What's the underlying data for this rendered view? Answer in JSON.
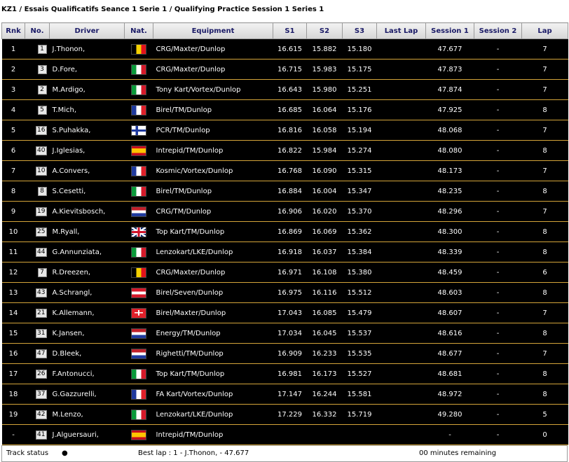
{
  "title": "KZ1 / Essais Qualificatifs Seance 1 Serie 1 / Qualifying Practice Session 1 Series 1",
  "columns": [
    "Rnk",
    "No.",
    "Driver",
    "Nat.",
    "Equipment",
    "S1",
    "S2",
    "S3",
    "Last Lap",
    "Session 1",
    "Session 2",
    "Lap"
  ],
  "rows": [
    {
      "rnk": "1",
      "no": "1",
      "driver": "J.Thonon,",
      "nat": "BE",
      "equip": "CRG/Maxter/Dunlop",
      "s1": "16.615",
      "s2": "15.882",
      "s3": "15.180",
      "last": "",
      "sess1": "47.677",
      "sess2": "-",
      "lap": "7"
    },
    {
      "rnk": "2",
      "no": "3",
      "driver": "D.Fore,",
      "nat": "IT",
      "equip": "CRG/Maxter/Dunlop",
      "s1": "16.715",
      "s2": "15.983",
      "s3": "15.175",
      "last": "",
      "sess1": "47.873",
      "sess2": "-",
      "lap": "7"
    },
    {
      "rnk": "3",
      "no": "2",
      "driver": "M.Ardigo,",
      "nat": "IT",
      "equip": "Tony Kart/Vortex/Dunlop",
      "s1": "16.643",
      "s2": "15.980",
      "s3": "15.251",
      "last": "",
      "sess1": "47.874",
      "sess2": "-",
      "lap": "7"
    },
    {
      "rnk": "4",
      "no": "5",
      "driver": "T.Mich,",
      "nat": "FR",
      "equip": "Birel/TM/Dunlop",
      "s1": "16.685",
      "s2": "16.064",
      "s3": "15.176",
      "last": "",
      "sess1": "47.925",
      "sess2": "-",
      "lap": "8"
    },
    {
      "rnk": "5",
      "no": "16",
      "driver": "S.Puhakka,",
      "nat": "FI",
      "equip": "PCR/TM/Dunlop",
      "s1": "16.816",
      "s2": "16.058",
      "s3": "15.194",
      "last": "",
      "sess1": "48.068",
      "sess2": "-",
      "lap": "7"
    },
    {
      "rnk": "6",
      "no": "40",
      "driver": "J.Iglesias,",
      "nat": "ES",
      "equip": "Intrepid/TM/Dunlop",
      "s1": "16.822",
      "s2": "15.984",
      "s3": "15.274",
      "last": "",
      "sess1": "48.080",
      "sess2": "-",
      "lap": "8"
    },
    {
      "rnk": "7",
      "no": "10",
      "driver": "A.Convers,",
      "nat": "FR",
      "equip": "Kosmic/Vortex/Dunlop",
      "s1": "16.768",
      "s2": "16.090",
      "s3": "15.315",
      "last": "",
      "sess1": "48.173",
      "sess2": "-",
      "lap": "7"
    },
    {
      "rnk": "8",
      "no": "8",
      "driver": "S.Cesetti,",
      "nat": "IT",
      "equip": "Birel/TM/Dunlop",
      "s1": "16.884",
      "s2": "16.004",
      "s3": "15.347",
      "last": "",
      "sess1": "48.235",
      "sess2": "-",
      "lap": "8"
    },
    {
      "rnk": "9",
      "no": "19",
      "driver": "A.Kievitsbosch,",
      "nat": "NL",
      "equip": "CRG/TM/Dunlop",
      "s1": "16.906",
      "s2": "16.020",
      "s3": "15.370",
      "last": "",
      "sess1": "48.296",
      "sess2": "-",
      "lap": "7"
    },
    {
      "rnk": "10",
      "no": "25",
      "driver": "M.Ryall,",
      "nat": "GB",
      "equip": "Top Kart/TM/Dunlop",
      "s1": "16.869",
      "s2": "16.069",
      "s3": "15.362",
      "last": "",
      "sess1": "48.300",
      "sess2": "-",
      "lap": "8"
    },
    {
      "rnk": "11",
      "no": "44",
      "driver": "G.Annunziata,",
      "nat": "IT",
      "equip": "Lenzokart/LKE/Dunlop",
      "s1": "16.918",
      "s2": "16.037",
      "s3": "15.384",
      "last": "",
      "sess1": "48.339",
      "sess2": "-",
      "lap": "8"
    },
    {
      "rnk": "12",
      "no": "7",
      "driver": "R.Dreezen,",
      "nat": "BE",
      "equip": "CRG/Maxter/Dunlop",
      "s1": "16.971",
      "s2": "16.108",
      "s3": "15.380",
      "last": "",
      "sess1": "48.459",
      "sess2": "-",
      "lap": "6"
    },
    {
      "rnk": "13",
      "no": "43",
      "driver": "A.Schrangl,",
      "nat": "AT",
      "equip": "Birel/Seven/Dunlop",
      "s1": "16.975",
      "s2": "16.116",
      "s3": "15.512",
      "last": "",
      "sess1": "48.603",
      "sess2": "-",
      "lap": "8"
    },
    {
      "rnk": "14",
      "no": "21",
      "driver": "K.Allemann,",
      "nat": "CH",
      "equip": "Birel/Maxter/Dunlop",
      "s1": "17.043",
      "s2": "16.085",
      "s3": "15.479",
      "last": "",
      "sess1": "48.607",
      "sess2": "-",
      "lap": "7"
    },
    {
      "rnk": "15",
      "no": "31",
      "driver": "K.Jansen,",
      "nat": "NL",
      "equip": "Energy/TM/Dunlop",
      "s1": "17.034",
      "s2": "16.045",
      "s3": "15.537",
      "last": "",
      "sess1": "48.616",
      "sess2": "-",
      "lap": "8"
    },
    {
      "rnk": "16",
      "no": "47",
      "driver": "D.Bleek,",
      "nat": "NL",
      "equip": "Righetti/TM/Dunlop",
      "s1": "16.909",
      "s2": "16.233",
      "s3": "15.535",
      "last": "",
      "sess1": "48.677",
      "sess2": "-",
      "lap": "7"
    },
    {
      "rnk": "17",
      "no": "26",
      "driver": "F.Antonucci,",
      "nat": "IT",
      "equip": "Top Kart/TM/Dunlop",
      "s1": "16.981",
      "s2": "16.173",
      "s3": "15.527",
      "last": "",
      "sess1": "48.681",
      "sess2": "-",
      "lap": "8"
    },
    {
      "rnk": "18",
      "no": "37",
      "driver": "G.Gazzurelli,",
      "nat": "FR",
      "equip": "FA Kart/Vortex/Dunlop",
      "s1": "17.147",
      "s2": "16.244",
      "s3": "15.581",
      "last": "",
      "sess1": "48.972",
      "sess2": "-",
      "lap": "8"
    },
    {
      "rnk": "19",
      "no": "42",
      "driver": "M.Lenzo,",
      "nat": "IT",
      "equip": "Lenzokart/LKE/Dunlop",
      "s1": "17.229",
      "s2": "16.332",
      "s3": "15.719",
      "last": "",
      "sess1": "49.280",
      "sess2": "-",
      "lap": "5"
    },
    {
      "rnk": "-",
      "no": "41",
      "driver": "J.Alguersauri,",
      "nat": "ES",
      "equip": "Intrepid/TM/Dunlop",
      "s1": "",
      "s2": "",
      "s3": "",
      "last": "",
      "sess1": "-",
      "sess2": "-",
      "lap": "0"
    }
  ],
  "footer": {
    "track_status_label": "Track status",
    "track_status_indicator": "●",
    "best_lap": "Best lap : 1 - J.Thonon, - 47.677",
    "remaining": "00 minutes remaining"
  },
  "colors": {
    "row_bg": "#000000",
    "row_border": "#d4a53a",
    "header_text": "#1a1a66"
  }
}
